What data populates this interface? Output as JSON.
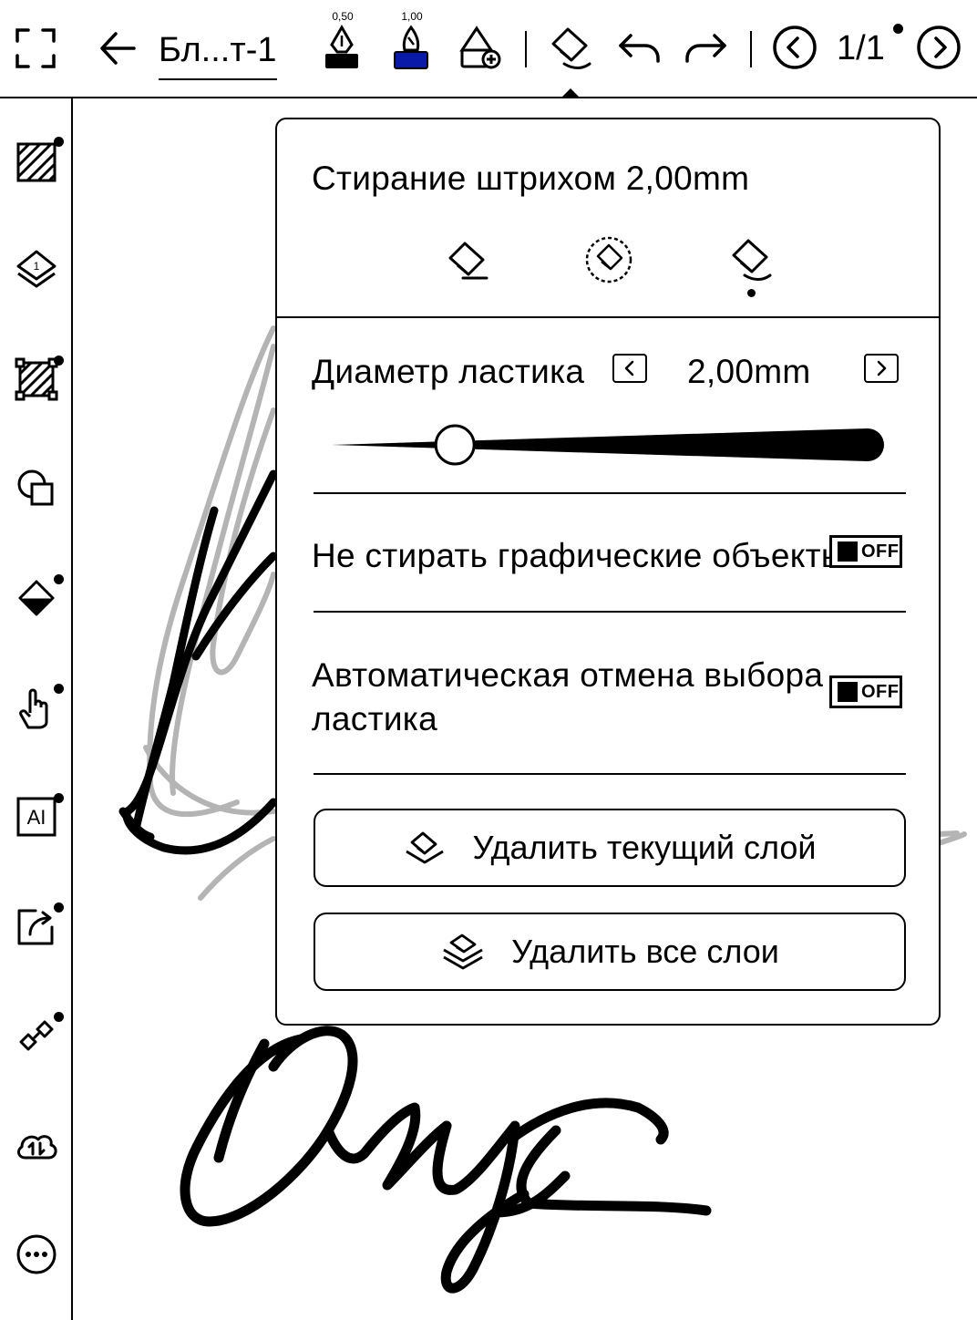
{
  "toolbar": {
    "doc_title": "Бл...т-1",
    "pen1_size": "0,50",
    "pen2_size": "1,00",
    "page_indicator": "1/1"
  },
  "panel": {
    "heading": "Стирание штрихом 2,00mm",
    "diameter_label": "Диаметр ластика",
    "diameter_value": "2,00mm",
    "diameter_fraction": 0.2,
    "option1_label": "Не стирать графические объекты",
    "option1_state": "OFF",
    "option2_label": "Автоматическая отмена выбора ластика",
    "option2_state": "OFF",
    "btn_delete_current": "Удалить текущий слой",
    "btn_delete_all": "Удалить все слои"
  },
  "colors": {
    "accent_pen": "#0a1aa8",
    "sketch_gray": "#b4b4b4"
  }
}
